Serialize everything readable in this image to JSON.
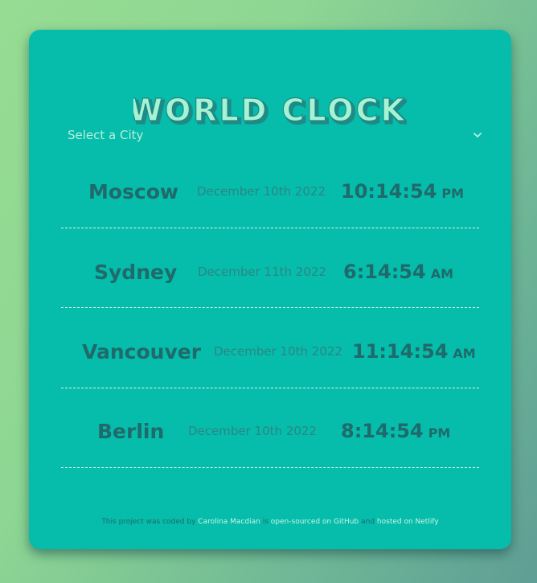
{
  "title": "WORLD CLOCK",
  "select": {
    "label": "Select a City"
  },
  "cities": [
    {
      "name": "Moscow",
      "date": "December 10th 2022",
      "time": "10:14:54",
      "ampm": "PM"
    },
    {
      "name": "Sydney",
      "date": "December 11th 2022",
      "time": "6:14:54",
      "ampm": "AM"
    },
    {
      "name": "Vancouver",
      "date": "December 10th 2022",
      "time": "11:14:54",
      "ampm": "AM"
    },
    {
      "name": "Berlin",
      "date": "December 10th 2022",
      "time": "8:14:54",
      "ampm": "PM"
    }
  ],
  "footer": {
    "prefix": "This project was coded by",
    "author": "Carolina Macdian",
    "mid1": "is",
    "source_link": "open-sourced on GitHub",
    "mid2": "and",
    "host_link": "hosted on Netlify"
  },
  "colors": {
    "card": "#06bcab",
    "title_fill": "#a6f3d3",
    "title_outline": "#1f8a86",
    "text_dark": "#1f6a6a",
    "link": "#c6f6e4"
  },
  "icons": {
    "select_arrow": "chevron-down-icon"
  }
}
